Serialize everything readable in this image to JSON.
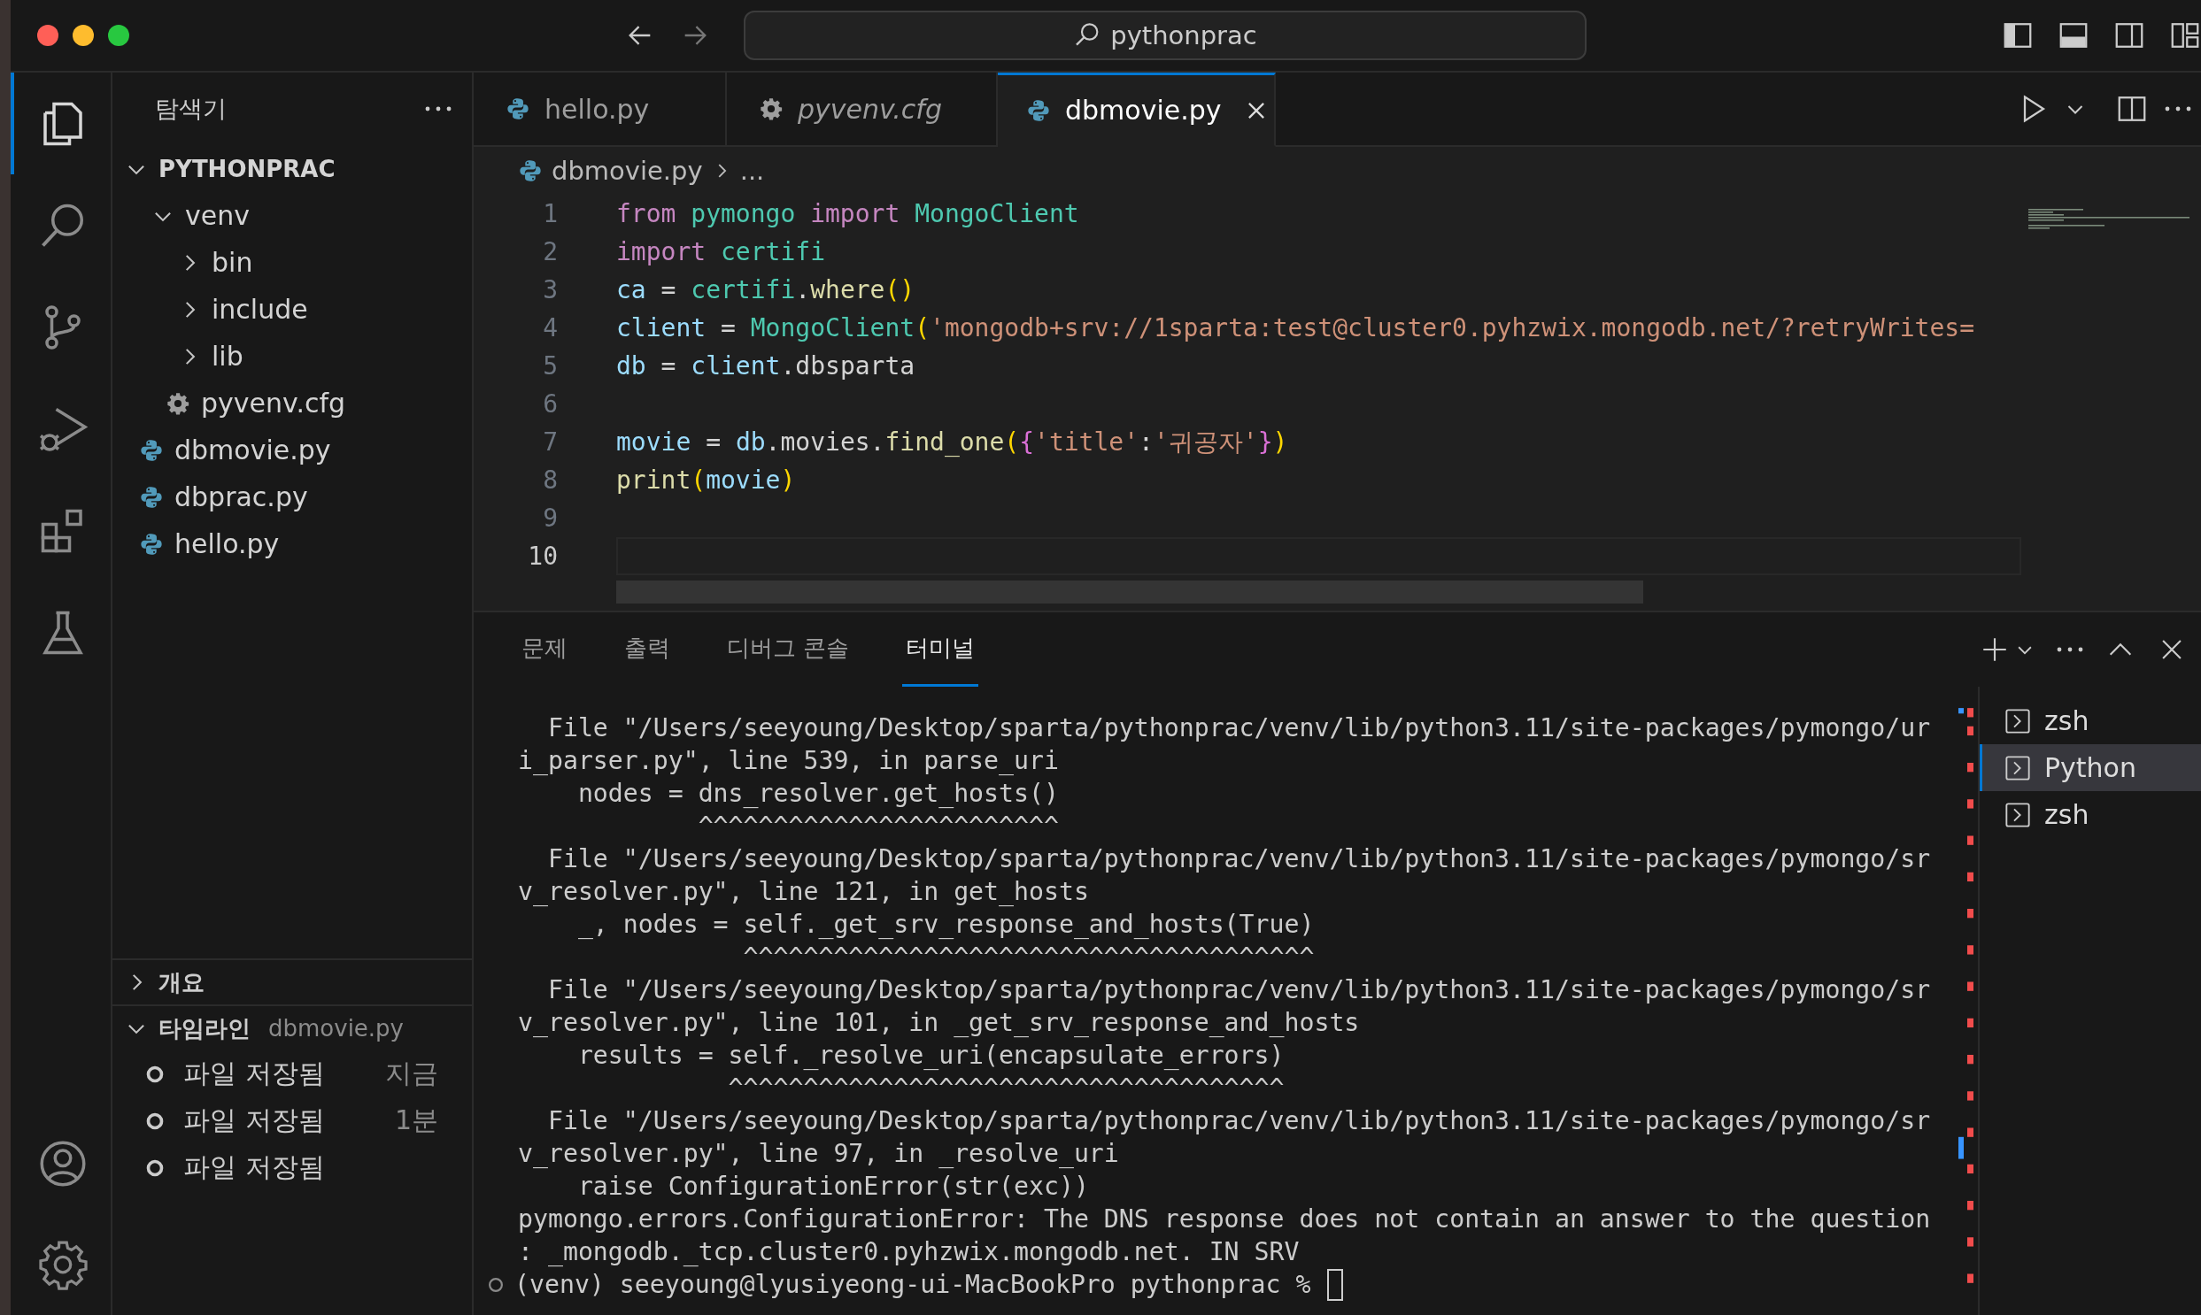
{
  "title_bar": {
    "search": "pythonprac"
  },
  "activity_bar": [
    {
      "kind": "explorer",
      "selected": true
    },
    {
      "kind": "search",
      "selected": false
    },
    {
      "kind": "source-control",
      "selected": false
    },
    {
      "kind": "run-debug",
      "selected": false
    },
    {
      "kind": "extensions",
      "selected": false
    },
    {
      "kind": "testing",
      "selected": false
    }
  ],
  "activity_bar_bottom": [
    {
      "kind": "account"
    },
    {
      "kind": "settings"
    }
  ],
  "sidebar": {
    "title": "탐색기",
    "tree": [
      {
        "label": "PYTHONPRAC",
        "kind": "root",
        "expanded": true,
        "children": [
          {
            "label": "venv",
            "kind": "folder",
            "expanded": true,
            "children": [
              {
                "label": "bin",
                "kind": "folder",
                "expanded": false
              },
              {
                "label": "include",
                "kind": "folder",
                "expanded": false
              },
              {
                "label": "lib",
                "kind": "folder",
                "expanded": false
              },
              {
                "label": "pyvenv.cfg",
                "kind": "config"
              }
            ]
          },
          {
            "label": "dbmovie.py",
            "kind": "python"
          },
          {
            "label": "dbprac.py",
            "kind": "python"
          },
          {
            "label": "hello.py",
            "kind": "python"
          }
        ]
      }
    ],
    "outline": {
      "title": "개요",
      "expanded": false
    },
    "timeline": {
      "title": "타임라인",
      "file": "dbmovie.py",
      "expanded": true,
      "items": [
        {
          "label": "파일 저장됨",
          "time": "지금"
        },
        {
          "label": "파일 저장됨",
          "time": "1분"
        },
        {
          "label": "파일 저장됨"
        }
      ]
    }
  },
  "editor": {
    "tabs": [
      {
        "label": "hello.py",
        "kind": "python",
        "selected": false,
        "preview": false
      },
      {
        "label": "pyvenv.cfg",
        "kind": "config",
        "selected": false,
        "preview": true
      },
      {
        "label": "dbmovie.py",
        "kind": "python",
        "selected": true,
        "preview": false
      }
    ],
    "breadcrumb": [
      "dbmovie.py",
      "..."
    ],
    "lines": [
      {
        "number": "1",
        "current": false,
        "tokens": [
          {
            "text": "from ",
            "kind": "keyword"
          },
          {
            "text": "pymongo ",
            "kind": "module"
          },
          {
            "text": "import ",
            "kind": "keyword"
          },
          {
            "text": "MongoClient",
            "kind": "module"
          }
        ]
      },
      {
        "number": "2",
        "current": false,
        "tokens": [
          {
            "text": "import ",
            "kind": "keyword"
          },
          {
            "text": "certifi",
            "kind": "module"
          }
        ]
      },
      {
        "number": "3",
        "current": false,
        "tokens": [
          {
            "text": "ca",
            "kind": "variable"
          },
          {
            "text": " = ",
            "kind": "plain"
          },
          {
            "text": "certifi",
            "kind": "module"
          },
          {
            "text": ".",
            "kind": "plain"
          },
          {
            "text": "where",
            "kind": "function"
          },
          {
            "text": "()",
            "kind": "bracket"
          }
        ]
      },
      {
        "number": "4",
        "current": false,
        "tokens": [
          {
            "text": "client",
            "kind": "variable"
          },
          {
            "text": " = ",
            "kind": "plain"
          },
          {
            "text": "MongoClient",
            "kind": "module"
          },
          {
            "text": "(",
            "kind": "bracket"
          },
          {
            "text": "'mongodb+srv://1sparta:test@cluster0.pyhzwix.mongodb.net/?retryWrites=",
            "kind": "string"
          }
        ]
      },
      {
        "number": "5",
        "current": false,
        "tokens": [
          {
            "text": "db",
            "kind": "variable"
          },
          {
            "text": " = ",
            "kind": "plain"
          },
          {
            "text": "client",
            "kind": "variable"
          },
          {
            "text": ".dbsparta",
            "kind": "plain"
          }
        ]
      },
      {
        "number": "6",
        "current": false
      },
      {
        "number": "7",
        "current": false,
        "tokens": [
          {
            "text": "movie",
            "kind": "variable"
          },
          {
            "text": " = ",
            "kind": "plain"
          },
          {
            "text": "db",
            "kind": "variable"
          },
          {
            "text": ".movies.",
            "kind": "plain"
          },
          {
            "text": "find_one",
            "kind": "function"
          },
          {
            "text": "(",
            "kind": "bracket"
          },
          {
            "text": "{",
            "kind": "brace"
          },
          {
            "text": "'title'",
            "kind": "string"
          },
          {
            "text": ":",
            "kind": "plain"
          },
          {
            "text": "'귀공자'",
            "kind": "string"
          },
          {
            "text": "}",
            "kind": "brace"
          },
          {
            "text": ")",
            "kind": "bracket"
          }
        ]
      },
      {
        "number": "8",
        "current": false,
        "tokens": [
          {
            "text": "print",
            "kind": "function"
          },
          {
            "text": "(",
            "kind": "bracket"
          },
          {
            "text": "movie",
            "kind": "variable"
          },
          {
            "text": ")",
            "kind": "bracket"
          }
        ]
      },
      {
        "number": "9",
        "current": false
      },
      {
        "number": "10",
        "current": true
      }
    ]
  },
  "panel": {
    "tabs": [
      {
        "label": "문제",
        "selected": false
      },
      {
        "label": "출력",
        "selected": false
      },
      {
        "label": "디버그 콘솔",
        "selected": false
      },
      {
        "label": "터미널",
        "selected": true
      }
    ],
    "terminal_lines": [
      "  File \"/Users/seeyoung/Desktop/sparta/pythonprac/venv/lib/python3.11/site-packages/pymongo/ur",
      "i_parser.py\", line 539, in parse_uri",
      "    nodes = dns_resolver.get_hosts()",
      "            ^^^^^^^^^^^^^^^^^^^^^^^^",
      "  File \"/Users/seeyoung/Desktop/sparta/pythonprac/venv/lib/python3.11/site-packages/pymongo/sr",
      "v_resolver.py\", line 121, in get_hosts",
      "    _, nodes = self._get_srv_response_and_hosts(True)",
      "               ^^^^^^^^^^^^^^^^^^^^^^^^^^^^^^^^^^^^^^",
      "  File \"/Users/seeyoung/Desktop/sparta/pythonprac/venv/lib/python3.11/site-packages/pymongo/sr",
      "v_resolver.py\", line 101, in _get_srv_response_and_hosts",
      "    results = self._resolve_uri(encapsulate_errors)",
      "              ^^^^^^^^^^^^^^^^^^^^^^^^^^^^^^^^^^^^^",
      "  File \"/Users/seeyoung/Desktop/sparta/pythonprac/venv/lib/python3.11/site-packages/pymongo/sr",
      "v_resolver.py\", line 97, in _resolve_uri",
      "    raise ConfigurationError(str(exc))",
      "pymongo.errors.ConfigurationError: The DNS response does not contain an answer to the question",
      ": _mongodb._tcp.cluster0.pyhzwix.mongodb.net. IN SRV"
    ],
    "prompt": "(venv) seeyoung@lyusiyeong-ui-MacBookPro pythonprac % ",
    "terminals": [
      {
        "label": "zsh",
        "selected": false
      },
      {
        "label": "Python",
        "selected": true
      },
      {
        "label": "zsh",
        "selected": false
      }
    ]
  }
}
